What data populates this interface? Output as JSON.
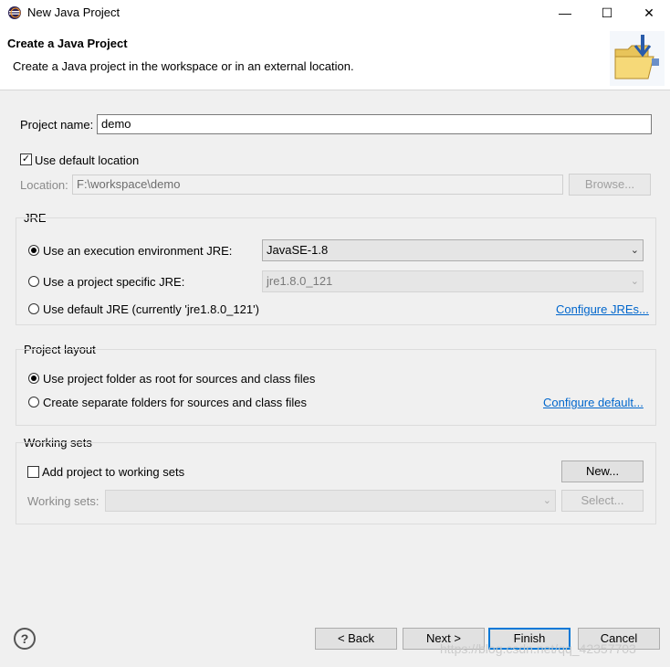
{
  "window": {
    "title": "New Java Project",
    "controls": {
      "minimize": "—",
      "maximize": "☐",
      "close": "✕"
    }
  },
  "header": {
    "title": "Create a Java Project",
    "description": "Create a Java project in the workspace or in an external location."
  },
  "project": {
    "name_label": "Project name:",
    "name_value": "demo",
    "use_default_location_label": "Use default location",
    "use_default_location_checked": true,
    "location_label": "Location:",
    "location_value": "F:\\workspace\\demo",
    "browse_label": "Browse..."
  },
  "jre": {
    "group_label": "JRE",
    "exec_env_label": "Use an execution environment JRE:",
    "exec_env_value": "JavaSE-1.8",
    "project_specific_label": "Use a project specific JRE:",
    "project_specific_value": "jre1.8.0_121",
    "default_jre_label": "Use default JRE (currently 'jre1.8.0_121')",
    "configure_link": "Configure JREs...",
    "selected": "exec_env"
  },
  "layout": {
    "group_label": "Project layout",
    "option_root_label": "Use project folder as root for sources and class files",
    "option_separate_label": "Create separate folders for sources and class files",
    "configure_link": "Configure default...",
    "selected": "root"
  },
  "working_sets": {
    "group_label": "Working sets",
    "add_label": "Add project to working sets",
    "add_checked": false,
    "new_label": "New...",
    "sets_label": "Working sets:",
    "select_label": "Select..."
  },
  "footer": {
    "help_icon": "?",
    "back_label": "< Back",
    "next_label": "Next >",
    "finish_label": "Finish",
    "cancel_label": "Cancel"
  },
  "watermark": "https://blog.csdn.net/qq_42357703"
}
